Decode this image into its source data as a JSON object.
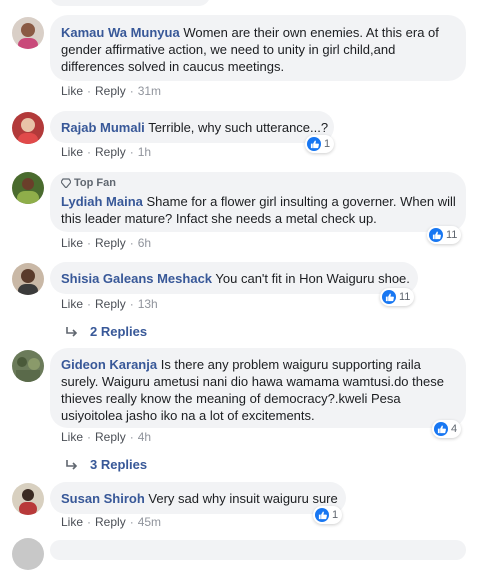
{
  "comments": [
    {
      "name": "Kamau Wa Munyua",
      "text": "Women are their own enemies. At this era of gender affirmative action, we need to unity in girl child,and differences solved in caucus meetings.",
      "like": "Like",
      "reply": "Reply",
      "time": "31m",
      "reactions": ""
    },
    {
      "name": "Rajab Mumali",
      "text": "Terrible, why such utterance...?",
      "like": "Like",
      "reply": "Reply",
      "time": "1h",
      "reactions": "1"
    },
    {
      "badge": "Top Fan",
      "name": "Lydiah Maina",
      "text": "Shame for a flower girl insulting a governer. When will this leader mature? Infact she needs a metal check up.",
      "like": "Like",
      "reply": "Reply",
      "time": "6h",
      "reactions": "11"
    },
    {
      "name": "Shisia Galeans Meshack",
      "text": "You can't fit in Hon Waiguru shoe.",
      "like": "Like",
      "reply": "Reply",
      "time": "13h",
      "reactions": "11",
      "replies": "2 Replies"
    },
    {
      "name": "Gideon Karanja",
      "text": "Is there any problem waiguru supporting raila surely. Waiguru ametusi nani dio hawa wamama wamtusi.do these thieves really know the meaning of democracy?.kweli Pesa usiyoitolea jasho iko na a lot of excitements.",
      "like": "Like",
      "reply": "Reply",
      "time": "4h",
      "reactions": "4",
      "replies": "3 Replies"
    },
    {
      "name": "Susan Shiroh",
      "text": "Very sad why insuit waiguru sure",
      "like": "Like",
      "reply": "Reply",
      "time": "45m",
      "reactions": "1"
    }
  ],
  "colors": {
    "name": "#385898",
    "bubble": "#f2f3f5",
    "like": "#1877f2"
  }
}
